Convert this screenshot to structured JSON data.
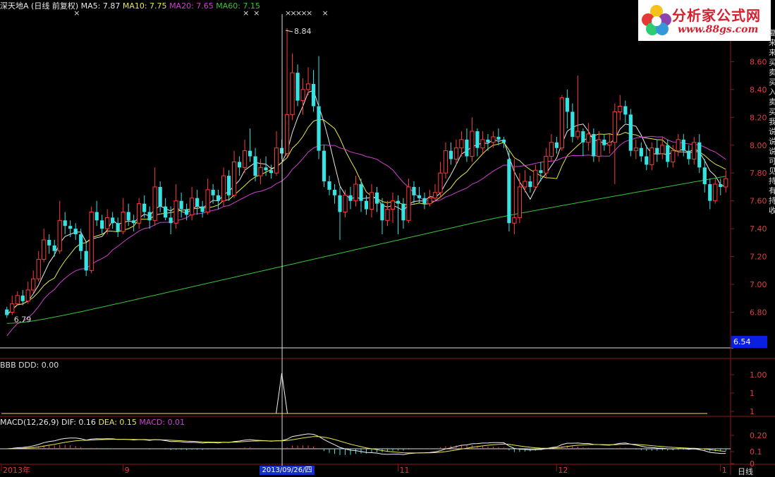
{
  "header": {
    "name": "深天地A",
    "period": "(日线 前复权)",
    "ma": [
      {
        "label": "MA5: 7.87",
        "color": "#e8e8e8"
      },
      {
        "label": "MA10: 7.75",
        "color": "#e8e84a"
      },
      {
        "label": "MA20: 7.65",
        "color": "#d23fd2"
      },
      {
        "label": "MA60: 7.15",
        "color": "#39c439"
      }
    ]
  },
  "logo": {
    "title": "分析家公式网",
    "url": "www.88gs.com"
  },
  "chart_data": [
    {
      "type": "candlestick",
      "panel": "price",
      "ylim": [
        6.54,
        8.84
      ],
      "y_ticks": [
        "8.60",
        "8.40",
        "8.20",
        "8.00",
        "7.80",
        "7.60",
        "7.40",
        "7.20",
        "7.00",
        "6.80"
      ],
      "high_label": "8.84",
      "low_label": "6.79",
      "current_price": "6.54",
      "x_labels": [
        "2013年",
        "9",
        "11",
        "12",
        "1"
      ],
      "selected_date": "2013/09/26/四",
      "period_label": "日线",
      "candles": [
        [
          6.82,
          6.78,
          6.84,
          6.76
        ],
        [
          6.8,
          6.86,
          6.92,
          6.78
        ],
        [
          6.86,
          6.92,
          6.95,
          6.85
        ],
        [
          6.92,
          6.88,
          6.96,
          6.85
        ],
        [
          6.88,
          6.96,
          7.02,
          6.86
        ],
        [
          6.96,
          7.04,
          7.1,
          6.94
        ],
        [
          7.04,
          7.18,
          7.24,
          7.02
        ],
        [
          7.18,
          7.32,
          7.4,
          7.16
        ],
        [
          7.32,
          7.28,
          7.36,
          7.22
        ],
        [
          7.28,
          7.24,
          7.32,
          7.2
        ],
        [
          7.24,
          7.46,
          7.6,
          7.22
        ],
        [
          7.46,
          7.42,
          7.52,
          7.36
        ],
        [
          7.42,
          7.4,
          7.46,
          7.34
        ],
        [
          7.4,
          7.36,
          7.44,
          7.32
        ],
        [
          7.36,
          7.24,
          7.4,
          7.18
        ],
        [
          7.24,
          7.1,
          7.3,
          7.06
        ],
        [
          7.1,
          7.52,
          7.56,
          7.08
        ],
        [
          7.52,
          7.46,
          7.6,
          7.42
        ],
        [
          7.46,
          7.4,
          7.5,
          7.36
        ],
        [
          7.4,
          7.48,
          7.54,
          7.36
        ],
        [
          7.48,
          7.44,
          7.52,
          7.4
        ],
        [
          7.44,
          7.38,
          7.48,
          7.34
        ],
        [
          7.38,
          7.52,
          7.62,
          7.36
        ],
        [
          7.52,
          7.46,
          7.58,
          7.42
        ],
        [
          7.46,
          7.44,
          7.5,
          7.38
        ],
        [
          7.44,
          7.58,
          7.62,
          7.4
        ],
        [
          7.58,
          7.52,
          7.64,
          7.48
        ],
        [
          7.52,
          7.46,
          7.56,
          7.4
        ],
        [
          7.46,
          7.7,
          7.84,
          7.42
        ],
        [
          7.7,
          7.56,
          7.74,
          7.52
        ],
        [
          7.56,
          7.48,
          7.62,
          7.46
        ],
        [
          7.48,
          7.44,
          7.56,
          7.36
        ],
        [
          7.44,
          7.6,
          7.72,
          7.4
        ],
        [
          7.6,
          7.54,
          7.66,
          7.48
        ],
        [
          7.54,
          7.5,
          7.58,
          7.46
        ],
        [
          7.5,
          7.62,
          7.7,
          7.46
        ],
        [
          7.62,
          7.56,
          7.68,
          7.5
        ],
        [
          7.56,
          7.52,
          7.6,
          7.48
        ],
        [
          7.52,
          7.68,
          7.76,
          7.5
        ],
        [
          7.68,
          7.64,
          7.72,
          7.58
        ],
        [
          7.64,
          7.6,
          7.68,
          7.54
        ],
        [
          7.6,
          7.78,
          7.84,
          7.56
        ],
        [
          7.78,
          7.64,
          7.82,
          7.6
        ],
        [
          7.64,
          7.88,
          7.96,
          7.62
        ],
        [
          7.88,
          7.84,
          7.92,
          7.78
        ],
        [
          7.84,
          7.96,
          8.04,
          7.8
        ],
        [
          7.96,
          7.92,
          8.12,
          7.88
        ],
        [
          7.92,
          7.78,
          7.98,
          7.74
        ],
        [
          7.78,
          7.84,
          7.9,
          7.72
        ],
        [
          7.84,
          7.82,
          7.92,
          7.78
        ],
        [
          7.82,
          7.8,
          7.86,
          7.76
        ],
        [
          7.8,
          7.98,
          8.1,
          7.78
        ],
        [
          7.98,
          7.94,
          8.04,
          7.9
        ],
        [
          7.94,
          8.22,
          8.84,
          7.92
        ],
        [
          8.22,
          8.52,
          8.66,
          8.18
        ],
        [
          8.52,
          8.32,
          8.58,
          8.28
        ],
        [
          8.32,
          8.4,
          8.48,
          8.22
        ],
        [
          8.4,
          8.44,
          8.56,
          8.36
        ],
        [
          8.44,
          8.28,
          8.54,
          8.24
        ],
        [
          8.28,
          7.96,
          8.64,
          7.9
        ],
        [
          7.96,
          7.74,
          8.0,
          7.7
        ],
        [
          7.74,
          7.68,
          7.78,
          7.64
        ],
        [
          7.68,
          7.64,
          7.72,
          7.58
        ],
        [
          7.64,
          7.52,
          7.7,
          7.32
        ],
        [
          7.52,
          7.64,
          7.68,
          7.48
        ],
        [
          7.64,
          7.6,
          7.7,
          7.54
        ],
        [
          7.6,
          7.72,
          7.78,
          7.56
        ],
        [
          7.72,
          7.6,
          7.76,
          7.52
        ],
        [
          7.6,
          7.54,
          7.64,
          7.5
        ],
        [
          7.54,
          7.66,
          7.72,
          7.48
        ],
        [
          7.66,
          7.58,
          7.7,
          7.52
        ],
        [
          7.58,
          7.46,
          7.62,
          7.36
        ],
        [
          7.46,
          7.54,
          7.6,
          7.42
        ],
        [
          7.54,
          7.6,
          7.66,
          7.44
        ],
        [
          7.6,
          7.58,
          7.64,
          7.36
        ],
        [
          7.58,
          7.46,
          7.62,
          7.4
        ],
        [
          7.46,
          7.7,
          7.76,
          7.44
        ],
        [
          7.7,
          7.64,
          7.74,
          7.58
        ],
        [
          7.64,
          7.62,
          7.7,
          7.58
        ],
        [
          7.62,
          7.58,
          7.66,
          7.54
        ],
        [
          7.58,
          7.62,
          7.68,
          7.56
        ],
        [
          7.62,
          7.66,
          7.72,
          7.6
        ],
        [
          7.66,
          7.8,
          7.88,
          7.62
        ],
        [
          7.8,
          7.96,
          8.02,
          7.76
        ],
        [
          7.96,
          7.9,
          8.02,
          7.86
        ],
        [
          7.9,
          7.98,
          8.04,
          7.86
        ],
        [
          7.98,
          8.04,
          8.1,
          7.92
        ],
        [
          8.04,
          7.92,
          8.12,
          7.88
        ],
        [
          7.92,
          8.1,
          8.2,
          7.88
        ],
        [
          8.1,
          7.98,
          8.12,
          7.92
        ],
        [
          7.98,
          8.04,
          8.1,
          7.94
        ],
        [
          8.04,
          8.02,
          8.08,
          7.96
        ],
        [
          8.02,
          8.06,
          8.1,
          7.98
        ],
        [
          8.06,
          8.04,
          8.12,
          8.0
        ],
        [
          8.04,
          8.02,
          8.06,
          7.98
        ],
        [
          7.9,
          7.44,
          7.96,
          7.38
        ],
        [
          7.44,
          7.48,
          7.9,
          7.36
        ],
        [
          7.48,
          7.7,
          7.8,
          7.44
        ],
        [
          7.7,
          7.74,
          7.82,
          7.66
        ],
        [
          7.74,
          7.7,
          7.78,
          7.66
        ],
        [
          7.7,
          7.82,
          7.86,
          7.68
        ],
        [
          7.82,
          7.8,
          7.88,
          7.74
        ],
        [
          7.8,
          7.92,
          7.98,
          7.76
        ],
        [
          7.92,
          8.02,
          8.08,
          7.88
        ],
        [
          8.02,
          7.98,
          8.06,
          7.94
        ],
        [
          7.98,
          8.34,
          8.36,
          7.96
        ],
        [
          8.34,
          8.24,
          8.4,
          8.12
        ],
        [
          8.24,
          8.06,
          8.3,
          8.02
        ],
        [
          8.06,
          8.1,
          8.5,
          8.04
        ],
        [
          8.1,
          8.02,
          8.12,
          7.92
        ],
        [
          8.02,
          8.08,
          8.16,
          7.96
        ],
        [
          8.08,
          7.92,
          8.12,
          7.88
        ],
        [
          7.92,
          8.04,
          8.1,
          7.88
        ],
        [
          8.04,
          8.0,
          8.08,
          7.96
        ],
        [
          8.0,
          8.02,
          8.08,
          7.94
        ],
        [
          8.02,
          8.24,
          8.3,
          7.72
        ],
        [
          8.24,
          8.28,
          8.36,
          8.18
        ],
        [
          8.28,
          8.22,
          8.32,
          8.16
        ],
        [
          8.22,
          7.96,
          8.26,
          7.92
        ],
        [
          7.96,
          7.98,
          8.04,
          7.9
        ],
        [
          7.98,
          7.92,
          8.02,
          7.88
        ],
        [
          7.92,
          7.86,
          8.0,
          7.82
        ],
        [
          7.86,
          7.98,
          8.02,
          7.82
        ],
        [
          7.98,
          7.94,
          8.04,
          7.88
        ],
        [
          7.94,
          8.0,
          8.06,
          7.9
        ],
        [
          8.0,
          7.88,
          8.04,
          7.84
        ],
        [
          7.88,
          7.96,
          8.0,
          7.84
        ],
        [
          7.96,
          8.04,
          8.08,
          7.92
        ],
        [
          8.04,
          7.96,
          8.08,
          7.92
        ],
        [
          7.96,
          7.9,
          8.0,
          7.86
        ],
        [
          7.9,
          8.02,
          8.06,
          7.86
        ],
        [
          8.02,
          7.84,
          8.08,
          7.8
        ],
        [
          7.84,
          7.72,
          7.9,
          7.66
        ],
        [
          7.72,
          7.6,
          7.76,
          7.54
        ],
        [
          7.6,
          7.72,
          7.76,
          7.58
        ],
        [
          7.72,
          7.7,
          7.76,
          7.64
        ],
        [
          7.7,
          7.76,
          7.82,
          7.66
        ]
      ]
    },
    {
      "type": "line",
      "panel": "indicator",
      "label": "BBB DDD: 0.00",
      "y_ticks": [
        "1.00",
        "1",
        "1"
      ],
      "values": [
        0,
        1.0,
        0
      ],
      "spike_index": 52
    },
    {
      "type": "bar",
      "panel": "macd",
      "params": "MACD(12,26,9)",
      "dif_label": "DIF: 0.16",
      "dea_label": "DEA: 0.15",
      "macd_label": "MACD: 0.01",
      "y_ticks": [
        "0.20",
        "0.1",
        "0"
      ]
    }
  ],
  "side_text": "复来来买卖买入卖买我说说说可见持有持收"
}
